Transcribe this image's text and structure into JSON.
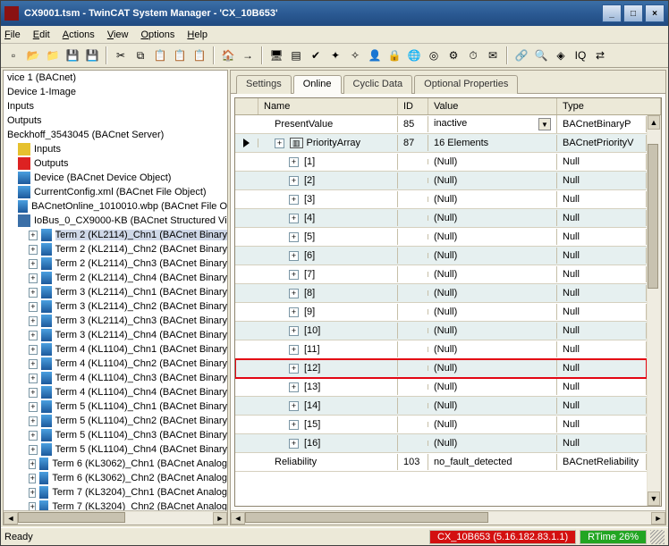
{
  "title": "CX9001.tsm - TwinCAT System Manager - 'CX_10B653'",
  "menu": {
    "file": "File",
    "edit": "Edit",
    "actions": "Actions",
    "view": "View",
    "options": "Options",
    "help": "Help"
  },
  "winbtns": {
    "min": "_",
    "max": "□",
    "close": "×"
  },
  "toolbar": [
    "new-icon",
    "open-icon",
    "open2-icon",
    "save-icon",
    "saveall-icon",
    "sep",
    "cut-icon",
    "copy-icon",
    "paste-icon",
    "paste2-icon",
    "paste3-icon",
    "sep",
    "nav-up-icon",
    "arrow-right-icon",
    "sep",
    "monitor-icon",
    "panel-icon",
    "check-icon",
    "wizard-icon",
    "wizard2-icon",
    "person-icon",
    "lock-icon",
    "globe-icon",
    "target-icon",
    "gear-icon",
    "clock-icon",
    "stamp-icon",
    "sep",
    "link-icon",
    "find-icon",
    "tag-icon",
    "iq-icon",
    "conn-icon"
  ],
  "tree": {
    "items": [
      {
        "ind": 0,
        "pm": "",
        "ic": "",
        "lbl": "vice 1 (BACnet)"
      },
      {
        "ind": 0,
        "pm": "",
        "ic": "",
        "lbl": "Device 1-Image"
      },
      {
        "ind": 0,
        "pm": "",
        "ic": "",
        "lbl": "Inputs"
      },
      {
        "ind": 0,
        "pm": "",
        "ic": "",
        "lbl": "Outputs"
      },
      {
        "ind": 0,
        "pm": "",
        "ic": "",
        "lbl": "Beckhoff_3543045 (BACnet Server)"
      },
      {
        "ind": 12,
        "pm": "",
        "ic": "ylw",
        "lbl": "Inputs"
      },
      {
        "ind": 12,
        "pm": "",
        "ic": "red",
        "lbl": "Outputs"
      },
      {
        "ind": 12,
        "pm": "",
        "ic": "bac",
        "lbl": "Device (BACnet Device Object)"
      },
      {
        "ind": 12,
        "pm": "",
        "ic": "bac",
        "lbl": "CurrentConfig.xml (BACnet File Object)"
      },
      {
        "ind": 12,
        "pm": "",
        "ic": "bac",
        "lbl": "BACnetOnline_1010010.wbp (BACnet File O"
      },
      {
        "ind": 12,
        "pm": "",
        "ic": "blu",
        "lbl": "IoBus_0_CX9000-KB (BACnet Structured Vi"
      },
      {
        "ind": 24,
        "pm": "+",
        "ic": "bac",
        "lbl": "Term 2 (KL2114)_Chn1 (BACnet Binary",
        "sel": true
      },
      {
        "ind": 24,
        "pm": "+",
        "ic": "bac",
        "lbl": "Term 2 (KL2114)_Chn2 (BACnet Binary"
      },
      {
        "ind": 24,
        "pm": "+",
        "ic": "bac",
        "lbl": "Term 2 (KL2114)_Chn3 (BACnet Binary"
      },
      {
        "ind": 24,
        "pm": "+",
        "ic": "bac",
        "lbl": "Term 2 (KL2114)_Chn4 (BACnet Binary"
      },
      {
        "ind": 24,
        "pm": "+",
        "ic": "bac",
        "lbl": "Term 3 (KL2114)_Chn1 (BACnet Binary"
      },
      {
        "ind": 24,
        "pm": "+",
        "ic": "bac",
        "lbl": "Term 3 (KL2114)_Chn2 (BACnet Binary"
      },
      {
        "ind": 24,
        "pm": "+",
        "ic": "bac",
        "lbl": "Term 3 (KL2114)_Chn3 (BACnet Binary"
      },
      {
        "ind": 24,
        "pm": "+",
        "ic": "bac",
        "lbl": "Term 3 (KL2114)_Chn4 (BACnet Binary"
      },
      {
        "ind": 24,
        "pm": "+",
        "ic": "bac",
        "lbl": "Term 4 (KL1104)_Chn1 (BACnet Binary"
      },
      {
        "ind": 24,
        "pm": "+",
        "ic": "bac",
        "lbl": "Term 4 (KL1104)_Chn2 (BACnet Binary"
      },
      {
        "ind": 24,
        "pm": "+",
        "ic": "bac",
        "lbl": "Term 4 (KL1104)_Chn3 (BACnet Binary"
      },
      {
        "ind": 24,
        "pm": "+",
        "ic": "bac",
        "lbl": "Term 4 (KL1104)_Chn4 (BACnet Binary"
      },
      {
        "ind": 24,
        "pm": "+",
        "ic": "bac",
        "lbl": "Term 5 (KL1104)_Chn1 (BACnet Binary"
      },
      {
        "ind": 24,
        "pm": "+",
        "ic": "bac",
        "lbl": "Term 5 (KL1104)_Chn2 (BACnet Binary"
      },
      {
        "ind": 24,
        "pm": "+",
        "ic": "bac",
        "lbl": "Term 5 (KL1104)_Chn3 (BACnet Binary"
      },
      {
        "ind": 24,
        "pm": "+",
        "ic": "bac",
        "lbl": "Term 5 (KL1104)_Chn4 (BACnet Binary"
      },
      {
        "ind": 24,
        "pm": "+",
        "ic": "bac",
        "lbl": "Term 6 (KL3062)_Chn1 (BACnet Analog"
      },
      {
        "ind": 24,
        "pm": "+",
        "ic": "bac",
        "lbl": "Term 6 (KL3062)_Chn2 (BACnet Analog"
      },
      {
        "ind": 24,
        "pm": "+",
        "ic": "bac",
        "lbl": "Term 7 (KL3204)_Chn1 (BACnet Analog"
      },
      {
        "ind": 24,
        "pm": "+",
        "ic": "bac",
        "lbl": "Term 7 (KL3204)_Chn2 (BACnet Analog"
      }
    ]
  },
  "tabs": [
    {
      "label": "Settings",
      "active": false
    },
    {
      "label": "Online",
      "active": true
    },
    {
      "label": "Cyclic Data",
      "active": false
    },
    {
      "label": "Optional Properties",
      "active": false
    }
  ],
  "grid": {
    "columns": {
      "name": "Name",
      "id": "ID",
      "value": "Value",
      "type": "Type"
    },
    "rows": [
      {
        "mark": "",
        "ind": 0,
        "pm": "",
        "name": "PresentValue",
        "id": "85",
        "value": "inactive",
        "dd": true,
        "type": "BACnetBinaryP",
        "alt": false
      },
      {
        "mark": "▶",
        "ind": 0,
        "pm": "+",
        "name": "PriorityArray",
        "id": "87",
        "value": "16 Elements",
        "type": "BACnetPriorityV",
        "alt": true,
        "boxed": true
      },
      {
        "mark": "",
        "ind": 1,
        "pm": "+",
        "name": "[1]",
        "id": "",
        "value": "(Null)",
        "type": "Null",
        "alt": false
      },
      {
        "mark": "",
        "ind": 1,
        "pm": "+",
        "name": "[2]",
        "id": "",
        "value": "(Null)",
        "type": "Null",
        "alt": true
      },
      {
        "mark": "",
        "ind": 1,
        "pm": "+",
        "name": "[3]",
        "id": "",
        "value": "(Null)",
        "type": "Null",
        "alt": false
      },
      {
        "mark": "",
        "ind": 1,
        "pm": "+",
        "name": "[4]",
        "id": "",
        "value": "(Null)",
        "type": "Null",
        "alt": true
      },
      {
        "mark": "",
        "ind": 1,
        "pm": "+",
        "name": "[5]",
        "id": "",
        "value": "(Null)",
        "type": "Null",
        "alt": false
      },
      {
        "mark": "",
        "ind": 1,
        "pm": "+",
        "name": "[6]",
        "id": "",
        "value": "(Null)",
        "type": "Null",
        "alt": true
      },
      {
        "mark": "",
        "ind": 1,
        "pm": "+",
        "name": "[7]",
        "id": "",
        "value": "(Null)",
        "type": "Null",
        "alt": false
      },
      {
        "mark": "",
        "ind": 1,
        "pm": "+",
        "name": "[8]",
        "id": "",
        "value": "(Null)",
        "type": "Null",
        "alt": true
      },
      {
        "mark": "",
        "ind": 1,
        "pm": "+",
        "name": "[9]",
        "id": "",
        "value": "(Null)",
        "type": "Null",
        "alt": false
      },
      {
        "mark": "",
        "ind": 1,
        "pm": "+",
        "name": "[10]",
        "id": "",
        "value": "(Null)",
        "type": "Null",
        "alt": true
      },
      {
        "mark": "",
        "ind": 1,
        "pm": "+",
        "name": "[11]",
        "id": "",
        "value": "(Null)",
        "type": "Null",
        "alt": false
      },
      {
        "mark": "",
        "ind": 1,
        "pm": "+",
        "name": "[12]",
        "id": "",
        "value": "(Null)",
        "type": "Null",
        "alt": true,
        "hl": true
      },
      {
        "mark": "",
        "ind": 1,
        "pm": "+",
        "name": "[13]",
        "id": "",
        "value": "(Null)",
        "type": "Null",
        "alt": false
      },
      {
        "mark": "",
        "ind": 1,
        "pm": "+",
        "name": "[14]",
        "id": "",
        "value": "(Null)",
        "type": "Null",
        "alt": true
      },
      {
        "mark": "",
        "ind": 1,
        "pm": "+",
        "name": "[15]",
        "id": "",
        "value": "(Null)",
        "type": "Null",
        "alt": false
      },
      {
        "mark": "",
        "ind": 1,
        "pm": "+",
        "name": "[16]",
        "id": "",
        "value": "(Null)",
        "type": "Null",
        "alt": true
      },
      {
        "mark": "",
        "ind": 0,
        "pm": "",
        "name": "Reliability",
        "id": "103",
        "value": "no_fault_detected",
        "type": "BACnetReliability",
        "alt": false
      }
    ]
  },
  "status": {
    "ready": "Ready",
    "host": "CX_10B653 (5.16.182.83.1.1)",
    "rtime": "RTime 26%"
  }
}
